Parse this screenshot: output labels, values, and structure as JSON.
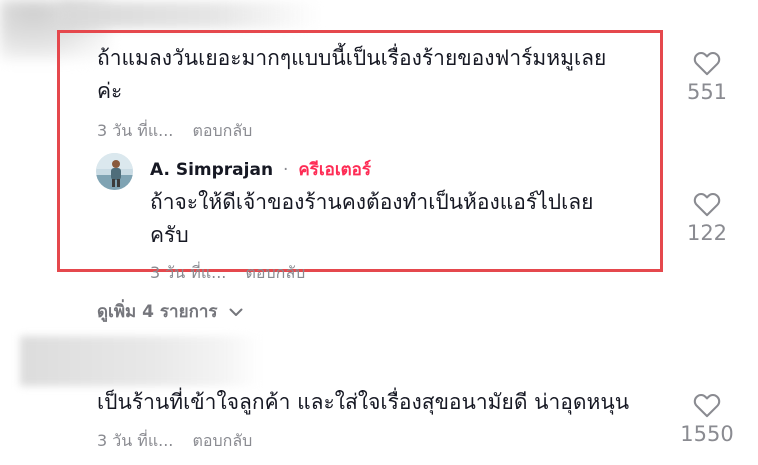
{
  "comment1": {
    "text_line1": "ถ้าแมลงวันเยอะมากๆแบบนี้เป็นเรื่องร้ายของฟาร์มหมูเลย",
    "text_line2": "ค่ะ",
    "time": "3 วัน ที่แ...",
    "reply_label": "ตอบกลับ",
    "likes": "551"
  },
  "reply": {
    "author": "A. Simprajan",
    "separator": "·",
    "badge": "ครีเอเตอร์",
    "text_line1": "ถ้าจะให้ดีเจ้าของร้านคงต้องทำเป็นห้องแอร์ไปเลย",
    "text_line2": "ครับ",
    "time": "3 วัน ที่แ...",
    "reply_label": "ตอบกลับ",
    "likes": "122"
  },
  "view_more": {
    "label": "ดูเพิ่ม 4 รายการ"
  },
  "comment2": {
    "text": "เป็นร้านที่เข้าใจลูกค้า และใส่ใจเรื่องสุขอนามัยดี น่าอุดหนุน",
    "time": "3 วัน ที่แ...",
    "reply_label": "ตอบกลับ",
    "likes": "1550"
  },
  "colors": {
    "highlight": "#e5484d",
    "creator_badge": "#fe2c55",
    "muted": "#8a8b91"
  },
  "icons": [
    "heart-icon",
    "chevron-down-icon"
  ]
}
